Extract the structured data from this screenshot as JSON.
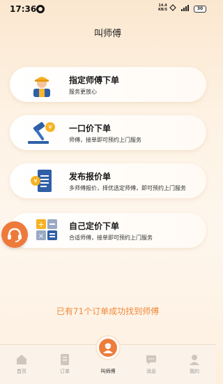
{
  "status_bar": {
    "time": "17:36",
    "net_speed_value": "14.4",
    "net_speed_unit": "KB/S",
    "battery": "30"
  },
  "page": {
    "title": "叫师傅"
  },
  "cards": [
    {
      "title": "指定师傅下单",
      "subtitle": "服务更放心",
      "icon": "worker-icon"
    },
    {
      "title": "一口价下单",
      "subtitle": "师傅，接单即可预约上门服务",
      "icon": "gavel-icon"
    },
    {
      "title": "发布报价单",
      "subtitle": "多师傅报价，择优选定师傅，即可预约上门服务",
      "icon": "quote-sheet-icon"
    },
    {
      "title": "自己定价下单",
      "subtitle": "合适师傅，接单即可预约上门服务",
      "icon": "calculator-icon"
    }
  ],
  "promo": {
    "text": "已有71个订单成功找到师傅"
  },
  "tabs": [
    {
      "label": "首页",
      "icon": "home-icon"
    },
    {
      "label": "订单",
      "icon": "order-icon"
    },
    {
      "label": "叫师傅",
      "icon": "worker-avatar-icon",
      "active": true
    },
    {
      "label": "消息",
      "icon": "message-icon"
    },
    {
      "label": "我的",
      "icon": "profile-icon"
    }
  ],
  "colors": {
    "accent": "#f08a3c",
    "accent_dark": "#ef7d3a",
    "background": "#fdf2e4"
  }
}
